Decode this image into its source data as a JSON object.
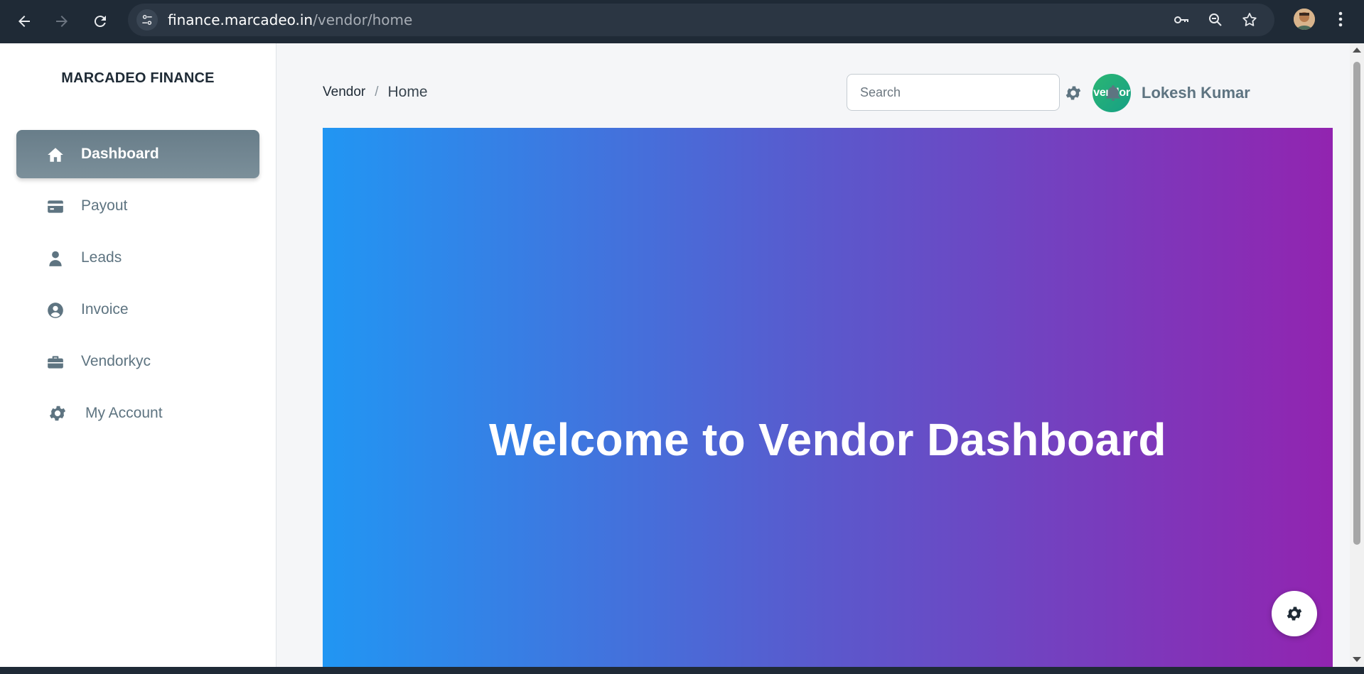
{
  "browser": {
    "url_host": "finance.marcadeo.in",
    "url_path": "/vendor/home"
  },
  "sidebar": {
    "brand": "MARCADEO FINANCE",
    "items": [
      {
        "label": "Dashboard",
        "icon": "home-icon",
        "active": true
      },
      {
        "label": "Payout",
        "icon": "credit-card-icon",
        "active": false
      },
      {
        "label": "Leads",
        "icon": "person-icon",
        "active": false
      },
      {
        "label": "Invoice",
        "icon": "account-circle-icon",
        "active": false
      },
      {
        "label": "Vendorkyc",
        "icon": "briefcase-icon",
        "active": false
      },
      {
        "label": "My Account",
        "icon": "gear-icon",
        "active": false
      }
    ]
  },
  "header": {
    "breadcrumb_root": "Vendor",
    "breadcrumb_separator": "/",
    "breadcrumb_current": "Home",
    "search_placeholder": "Search",
    "avatar_text": "vendor",
    "user_name": "Lokesh Kumar"
  },
  "hero": {
    "title": "Welcome to Vendor Dashboard",
    "gradient_start": "#2196f3",
    "gradient_end": "#9224b0"
  },
  "colors": {
    "sidebar_text": "#5e7481",
    "active_item": "#6f8490",
    "avatar_bg": "#2bb673"
  }
}
